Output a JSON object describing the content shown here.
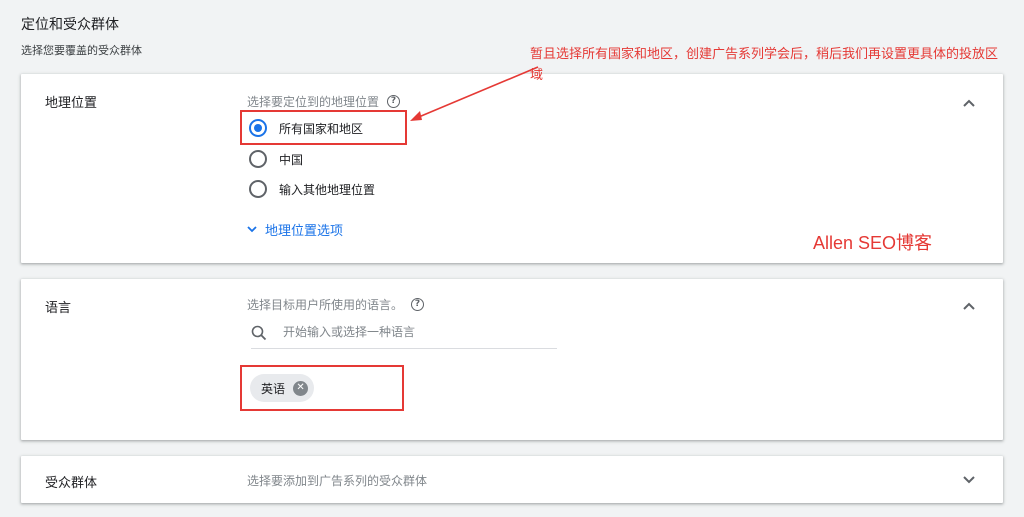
{
  "header": {
    "title": "定位和受众群体",
    "subtitle": "选择您要覆盖的受众群体"
  },
  "geo": {
    "label": "地理位置",
    "hint": "选择要定位到的地理位置",
    "options": [
      {
        "label": "所有国家和地区",
        "selected": true
      },
      {
        "label": "中国",
        "selected": false
      },
      {
        "label": "输入其他地理位置",
        "selected": false
      }
    ],
    "options_link": "地理位置选项"
  },
  "language": {
    "label": "语言",
    "hint": "选择目标用户所使用的语言。",
    "search_placeholder": "开始输入或选择一种语言",
    "chips": [
      "英语"
    ]
  },
  "audience": {
    "label": "受众群体",
    "hint": "选择要添加到广告系列的受众群体"
  },
  "annotation": {
    "text": "暂且选择所有国家和地区，创建广告系列学会后，稍后我们再设置更具体的投放区域",
    "watermark": "Allen SEO博客"
  },
  "colors": {
    "accent": "#1a73e8",
    "annotation_red": "#e53935",
    "background": "#f1f3f4"
  },
  "icons": {
    "help": "question-circle-icon",
    "collapse": "chevron-up-icon",
    "expand": "chevron-down-icon",
    "search": "search-icon",
    "remove_chip": "close-circle-icon"
  }
}
